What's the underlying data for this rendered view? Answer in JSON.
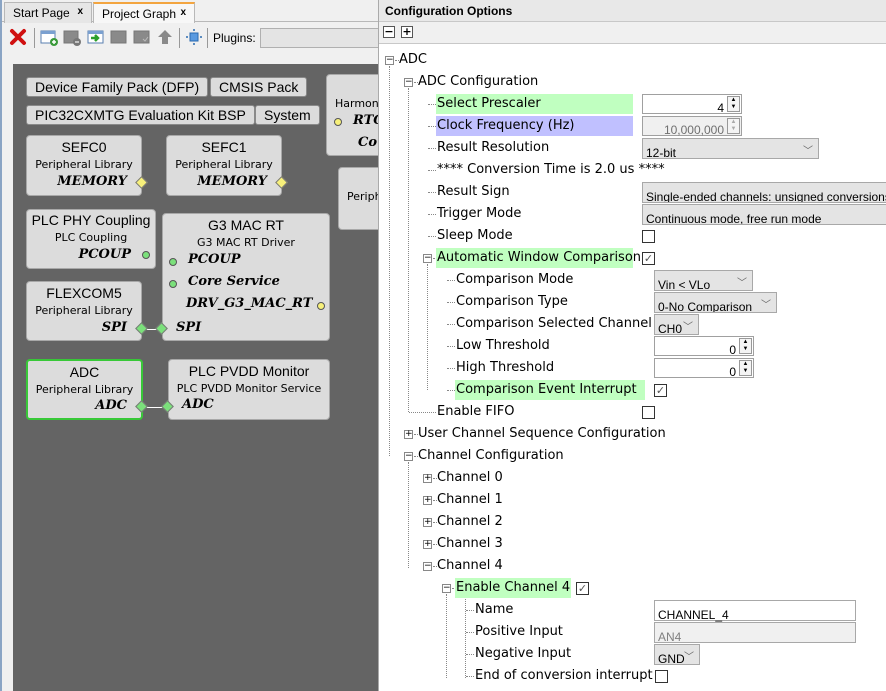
{
  "tabs": [
    {
      "label": "Start Page",
      "close": "x",
      "active": false
    },
    {
      "label": "Project Graph",
      "close": "x",
      "active": true
    }
  ],
  "toolbar": {
    "icons": [
      "delete-icon",
      "add-component-icon",
      "remove-component-icon",
      "import-icon",
      "window-disabled-icon",
      "window-check-icon",
      "up-arrow-icon",
      "fit-view-icon"
    ],
    "plugins_label": "Plugins:",
    "plugins_value": ""
  },
  "graph": {
    "pills": [
      "Device Family Pack (DFP)",
      "CMSIS Pack",
      "PIC32CXMTG Evaluation Kit BSP",
      "System"
    ],
    "nodes": {
      "sefc0": {
        "title": "SEFC0",
        "sub": "Peripheral Library",
        "port": "MEMORY"
      },
      "sefc1": {
        "title": "SEFC1",
        "sub": "Peripheral Library",
        "port": "MEMORY"
      },
      "harmony": {
        "sub": "Harmon",
        "port1": "RTO",
        "port2": "Co"
      },
      "periph": {
        "sub": "Periph"
      },
      "plc_phy": {
        "title": "PLC PHY Coupling",
        "sub": "PLC Coupling",
        "port": "PCOUP"
      },
      "g3mac": {
        "title": "G3 MAC RT",
        "sub": "G3 MAC RT Driver",
        "port1": "PCOUP",
        "port2": "Core Service",
        "port3": "DRV_G3_MAC_RT",
        "port4": "SPI"
      },
      "flexcom5": {
        "title": "FLEXCOM5",
        "sub": "Peripheral Library",
        "port": "SPI"
      },
      "adc": {
        "title": "ADC",
        "sub": "Peripheral Library",
        "port": "ADC"
      },
      "pvdd": {
        "title": "PLC PVDD Monitor",
        "sub": "PLC PVDD Monitor Service",
        "port": "ADC"
      }
    }
  },
  "config": {
    "title": "Configuration Options",
    "collapse_all": "−",
    "expand_all": "+",
    "root": "ADC",
    "adc_config": "ADC Configuration",
    "select_prescaler": {
      "label": "Select Prescaler",
      "value": "4"
    },
    "clock_freq": {
      "label": "Clock Frequency (Hz)",
      "value": "10,000,000"
    },
    "result_resolution": {
      "label": "Result Resolution",
      "value": "12-bit"
    },
    "conversion_time": "**** Conversion Time is 2.0 us ****",
    "result_sign": {
      "label": "Result Sign",
      "value": "Single-ended channels: unsigned conversions Differential"
    },
    "trigger_mode": {
      "label": "Trigger Mode",
      "value": "Continuous mode, free run mode"
    },
    "sleep_mode": {
      "label": "Sleep Mode",
      "checked": false
    },
    "auto_window": {
      "label": "Automatic Window Comparison",
      "checked": true
    },
    "comparison_mode": {
      "label": "Comparison Mode",
      "value": "Vin < VLo"
    },
    "comparison_type": {
      "label": "Comparison Type",
      "value": "0-No Comparison"
    },
    "comparison_channel": {
      "label": "Comparison Selected Channel",
      "value": "CH0"
    },
    "low_threshold": {
      "label": "Low Threshold",
      "value": "0"
    },
    "high_threshold": {
      "label": "High Threshold",
      "value": "0"
    },
    "comparison_interrupt": {
      "label": "Comparison Event Interrupt",
      "checked": true
    },
    "enable_fifo": {
      "label": "Enable FIFO",
      "checked": false
    },
    "user_seq": "User Channel Sequence Configuration",
    "channel_config": "Channel Configuration",
    "channels": [
      "Channel 0",
      "Channel 1",
      "Channel 2",
      "Channel 3",
      "Channel 4"
    ],
    "enable_ch4": {
      "label": "Enable Channel 4",
      "checked": true
    },
    "name": {
      "label": "Name",
      "value": "CHANNEL_4"
    },
    "positive_input": {
      "label": "Positive Input",
      "value": "AN4"
    },
    "negative_input": {
      "label": "Negative Input",
      "value": "GND"
    },
    "eoc_interrupt": {
      "label": "End of conversion interrupt",
      "checked": false
    },
    "check_glyph": "✓",
    "chevron": "﹀"
  },
  "colors": {
    "highlight_green": "#c0ffc0",
    "highlight_blue": "#c0c0ff",
    "canvas_bg": "#646464",
    "selected_border": "#38c838",
    "tab_accent": "#f3a540"
  }
}
